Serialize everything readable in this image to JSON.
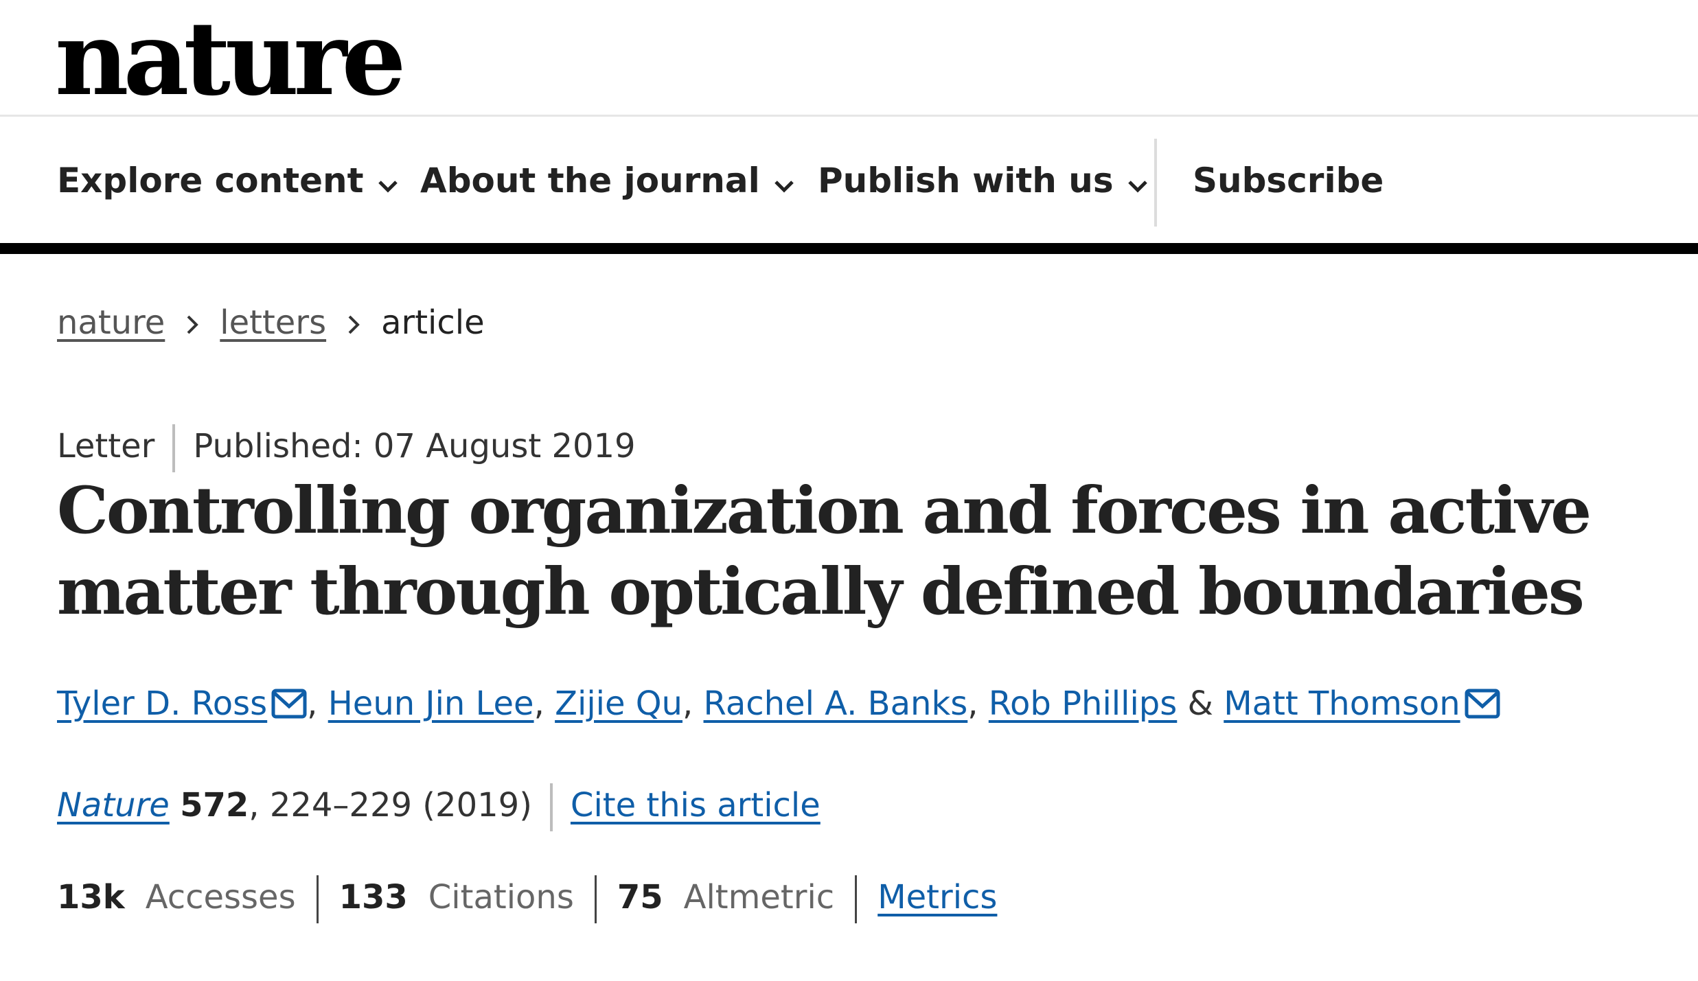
{
  "header": {
    "logo": "nature"
  },
  "nav": {
    "items": [
      {
        "label": "Explore content"
      },
      {
        "label": "About the journal"
      },
      {
        "label": "Publish with us"
      }
    ],
    "subscribe": "Subscribe"
  },
  "breadcrumb": {
    "items": [
      "nature",
      "letters"
    ],
    "current": "article"
  },
  "article": {
    "type": "Letter",
    "published": "Published: 07 August 2019",
    "title": "Controlling organization and forces in active matter through optically defined boundaries",
    "authors": [
      {
        "name": "Tyler D. Ross"
      },
      {
        "name": "Heun Jin Lee"
      },
      {
        "name": "Zijie Qu"
      },
      {
        "name": "Rachel A. Banks"
      },
      {
        "name": "Rob Phillips"
      },
      {
        "name": "Matt Thomson"
      }
    ],
    "separators": {
      "comma": ",",
      "amp": "&"
    },
    "citation": {
      "journal": "Nature",
      "volume": "572",
      "pages_year": ", 224–229 (2019)",
      "cite_label": "Cite this article"
    },
    "metrics": {
      "accesses_value": "13k",
      "accesses_label": "Accesses",
      "citations_value": "133",
      "citations_label": "Citations",
      "altmetric_value": "75",
      "altmetric_label": "Altmetric",
      "metrics_link": "Metrics"
    }
  },
  "icons": {
    "chevron": "chevron-down-icon",
    "breadcrumb_separator": "chevron-right-icon",
    "mail": "mail-icon"
  },
  "colors": {
    "link": "#0f5ea8",
    "text": "#222222",
    "nav_rule": "#000000"
  }
}
